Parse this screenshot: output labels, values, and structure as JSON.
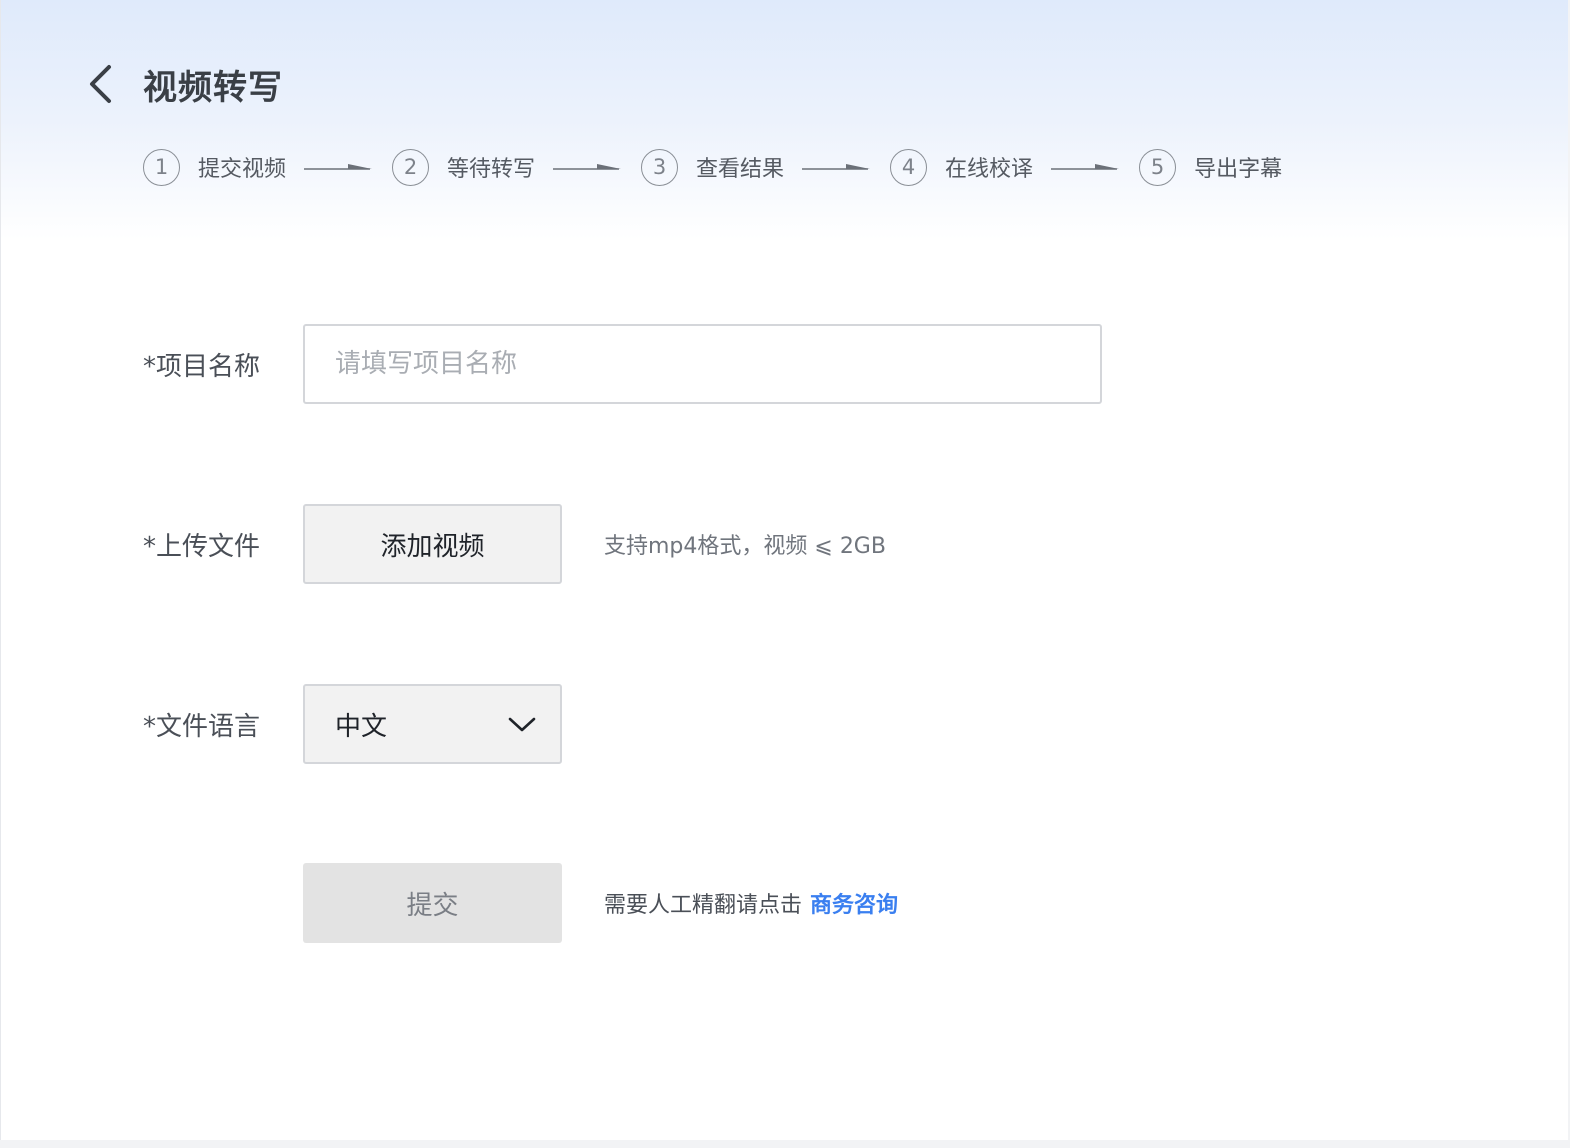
{
  "header": {
    "back_icon": "chevron-left-icon",
    "title": "视频转写"
  },
  "steps": [
    {
      "num": "1",
      "label": "提交视频"
    },
    {
      "num": "2",
      "label": "等待转写"
    },
    {
      "num": "3",
      "label": "查看结果"
    },
    {
      "num": "4",
      "label": "在线校译"
    },
    {
      "num": "5",
      "label": "导出字幕"
    }
  ],
  "form": {
    "project_name": {
      "label": "*项目名称",
      "placeholder": "请填写项目名称",
      "value": ""
    },
    "upload": {
      "label": "*上传文件",
      "button_label": "添加视频",
      "hint": "支持mp4格式，视频 ⩽ 2GB"
    },
    "language": {
      "label": "*文件语言",
      "selected": "中文",
      "icon": "chevron-down-icon"
    },
    "submit": {
      "button_label": "提交",
      "contact_text": "需要人工精翻请点击",
      "contact_link": "商务咨询"
    }
  },
  "colors": {
    "link": "#3a7ff0",
    "title": "#3a3f46",
    "header_gradient_top": "#dfeafb"
  }
}
